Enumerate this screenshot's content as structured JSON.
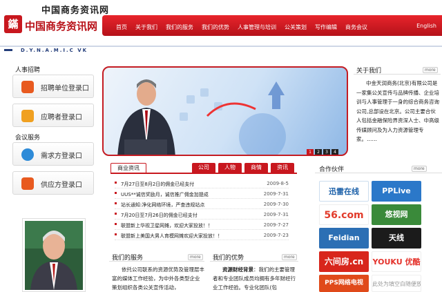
{
  "header": {
    "site_title": "中国商务资讯网",
    "logo_text": "中国商务资讯网",
    "nav": [
      "首页",
      "关于我们",
      "我们的服务",
      "我们的优势",
      "人事管理与培训",
      "公关策划",
      "写作编辑",
      "商务会议"
    ],
    "english_link": "English",
    "dynamic_label": "D.Y.N.A.M.I.C VK"
  },
  "sidebar": {
    "recruit_title": "人事招聘",
    "recruit_buttons": [
      "招聘单位登录口",
      "应聘者登录口"
    ],
    "meeting_title": "会议服务",
    "meeting_buttons": [
      "需求方登录口",
      "供应方登录口"
    ]
  },
  "banner": {
    "pages": [
      "1",
      "2",
      "3",
      "4"
    ]
  },
  "about": {
    "title": "关于我们",
    "more": "more",
    "text": "中金天润商务(北京)有限公司是一家集公关宣传与品牌传播、企业培训与人事管理于一身的综合商务咨询公司,总部设在北京。公司主要合伙人包括金融保险界资深人士、中高级传媒顾问及为人力资源管理专家。……"
  },
  "news": {
    "tabs": [
      "商业资讯",
      "公司",
      "人物",
      "商情",
      "资讯"
    ],
    "rows": [
      {
        "title": "7月27日至8月2日的佣金已经支付",
        "date": "2009-8-5"
      },
      {
        "title": "UUS**诚信奖励月，诚信推广佣金加提成",
        "date": "2009-7-31"
      },
      {
        "title": "站长通知:净化网络环境，严查违规站点",
        "date": "2009-7-30"
      },
      {
        "title": "7月20日至7月26日的佣金已经支付",
        "date": "2009-7-31"
      },
      {
        "title": "联盟新上华视卫星网摊，欢迎大家投放！！",
        "date": "2009-7-27"
      },
      {
        "title": "联盟新上美国大男人育模网摊欢迎大家投放！！",
        "date": "2009-7-23"
      }
    ]
  },
  "services": {
    "title": "我们的服务",
    "more": "more",
    "text": "依托公司联系的资源优势及管理层丰富的媒体工作经验，为中外各类型企业策划组织各类公关宣传活动，"
  },
  "advantage": {
    "title": "我们的优势",
    "more": "more",
    "lead": "资源财经背景",
    "text": "：我们的主要管理者和专业团队成员均拥有多年财经行业工作经验。专业化团队(包"
  },
  "partners": {
    "title": "合作伙伴",
    "more": "more",
    "items": [
      {
        "name": "迅雷在线",
        "sub": "www.xunlei.com",
        "color": "#1a5fa8"
      },
      {
        "name": "PPLive",
        "sub": "",
        "color": "#2b78c9"
      },
      {
        "name": "56.com",
        "sub": "",
        "color": "#e23b2b"
      },
      {
        "name": "悠视网",
        "sub": "UUSee.com",
        "color": "#3a8a3a"
      },
      {
        "name": "Feidian",
        "sub": "",
        "color": "#2c6fb4"
      },
      {
        "name": "天线",
        "sub": "",
        "color": "#1b1b1b"
      },
      {
        "name": "六间房",
        "sub": ".cn",
        "color": "#d8261c"
      },
      {
        "name": "YOUKU 优酷",
        "sub": "",
        "color": "#ffffff"
      },
      {
        "name": "PPS网络电视",
        "sub": "",
        "color": "#e04a1a"
      },
      {
        "name": "此处为填空白随便放的",
        "sub": "",
        "color": "#ffffff"
      }
    ]
  }
}
